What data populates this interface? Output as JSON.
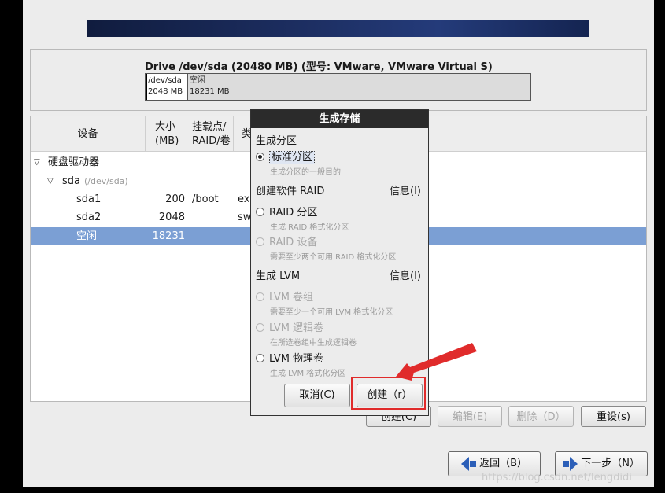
{
  "drive": {
    "title": "Drive /dev/sda (20480 MB) (型号: VMware, VMware Virtual S)",
    "segments": [
      {
        "name": "/dev/sda",
        "size": "2048 MB"
      },
      {
        "name": "空闲",
        "size": "18231 MB"
      }
    ]
  },
  "table": {
    "headers": {
      "device": "设备",
      "size_line1": "大小",
      "size_line2": "(MB)",
      "mount_line1": "挂载点/",
      "mount_line2": "RAID/卷",
      "type": "类"
    },
    "rows": [
      {
        "label": "硬盘驱动器"
      },
      {
        "label": "sda",
        "sub": "(/dev/sda)"
      },
      {
        "device": "sda1",
        "size": "200",
        "mount": "/boot",
        "type": "ex"
      },
      {
        "device": "sda2",
        "size": "2048",
        "mount": "",
        "type": "sw"
      },
      {
        "device": "空闲",
        "size": "18231",
        "mount": "",
        "type": ""
      }
    ]
  },
  "buttons": {
    "create": "创建(C)",
    "edit": "编辑(E)",
    "delete": "删除（D）",
    "reset": "重设(s)"
  },
  "nav": {
    "back": "返回（B）",
    "next": "下一步（N）"
  },
  "dialog": {
    "title": "生成存储",
    "section_partition": "生成分区",
    "standard_partition": "标准分区",
    "standard_hint": "生成分区的一般目的",
    "section_raid": "创建软件 RAID",
    "info1": "信息(I)",
    "raid_partition": "RAID 分区",
    "raid_partition_hint": "生成 RAID 格式化分区",
    "raid_device": "RAID 设备",
    "raid_device_hint": "需要至少两个可用 RAID 格式化分区",
    "section_lvm": "生成 LVM",
    "info2": "信息(I)",
    "lvm_vg": "LVM 卷组",
    "lvm_vg_hint": "需要至少一个可用 LVM 格式化分区",
    "lvm_lv": "LVM 逻辑卷",
    "lvm_lv_hint": "在所选卷组中生成逻辑卷",
    "lvm_pv": "LVM 物理卷",
    "lvm_pv_hint": "生成 LVM 格式化分区",
    "cancel": "取消(C)",
    "create": "创建（r）"
  },
  "annotation": {
    "color": "#e02b2b"
  },
  "watermark": "https://blog.csdn.net/lengdidi"
}
